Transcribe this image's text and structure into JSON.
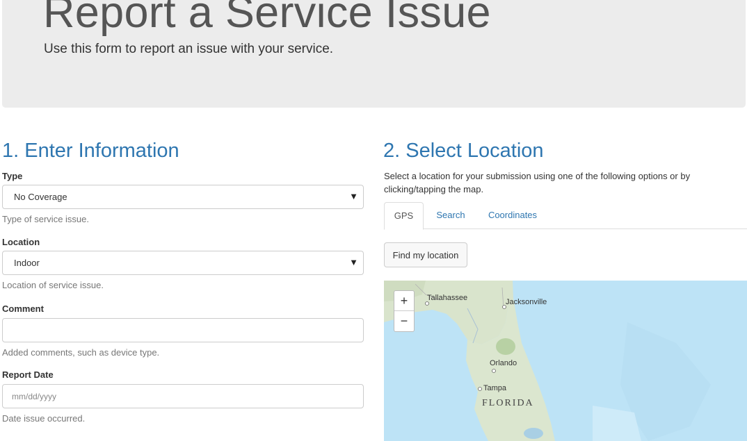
{
  "header": {
    "title": "Report a Service Issue",
    "subtitle": "Use this form to report an issue with your service."
  },
  "info_section": {
    "heading": "1. Enter Information",
    "type": {
      "label": "Type",
      "value": "No Coverage",
      "help": "Type of service issue."
    },
    "location": {
      "label": "Location",
      "value": "Indoor",
      "help": "Location of service issue."
    },
    "comment": {
      "label": "Comment",
      "value": "",
      "help": "Added comments, such as device type."
    },
    "report_date": {
      "label": "Report Date",
      "placeholder": "mm/dd/yyyy",
      "help": "Date issue occurred."
    }
  },
  "location_section": {
    "heading": "2. Select Location",
    "description": "Select a location for your submission using one of the following options or by clicking/tapping the map.",
    "tabs": [
      {
        "label": "GPS",
        "active": true
      },
      {
        "label": "Search",
        "active": false
      },
      {
        "label": "Coordinates",
        "active": false
      }
    ],
    "find_button": "Find my location"
  },
  "map": {
    "zoom_in": "+",
    "zoom_out": "−",
    "labels": {
      "tallahassee": "Tallahassee",
      "jacksonville": "Jacksonville",
      "orlando": "Orlando",
      "tampa": "Tampa",
      "state": "FLORIDA"
    }
  },
  "icons": {
    "caret": "chevron-down-icon"
  }
}
